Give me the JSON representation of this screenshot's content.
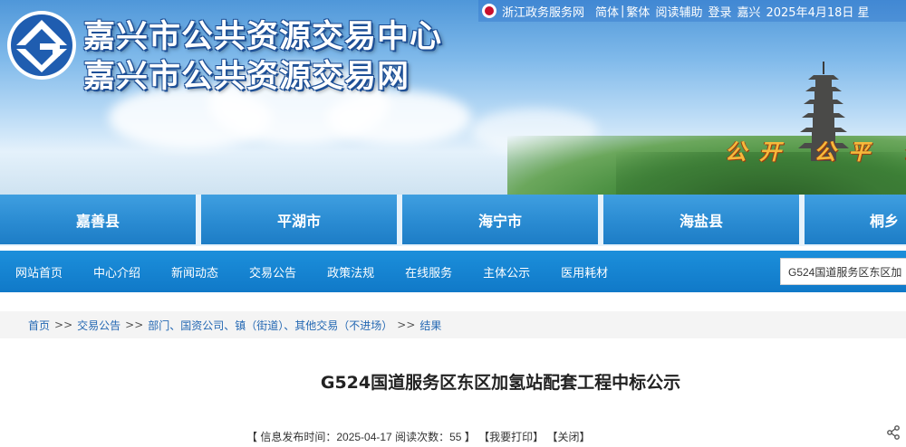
{
  "header": {
    "title_line1": "嘉兴市公共资源交易中心",
    "title_line2": "嘉兴市公共资源交易网",
    "slogan": "公开 公平 公",
    "topbar": {
      "gov_link": "浙江政务服务网",
      "simplified": "简体",
      "separator": "|",
      "traditional": "繁体",
      "reading_aid": "阅读辅助",
      "login": "登录",
      "city": "嘉兴",
      "date": "2025年4月18日 星"
    }
  },
  "city_tabs": [
    "嘉善县",
    "平湖市",
    "海宁市",
    "海盐县",
    "桐乡"
  ],
  "nav": {
    "items": [
      "网站首页",
      "中心介绍",
      "新闻动态",
      "交易公告",
      "政策法规",
      "在线服务",
      "主体公示",
      "医用耗材"
    ],
    "search_value": "G524国道服务区东区加"
  },
  "breadcrumb": [
    "首页",
    "交易公告",
    "部门、国资公司、镇（街道）、其他交易（不进场）",
    "结果"
  ],
  "breadcrumb_sep": ">>",
  "article": {
    "title": "G524国道服务区东区加氢站配套工程中标公示",
    "meta_prefix": "【 信息发布时间：",
    "publish_time": "2025-04-17",
    "views_label": "阅读次数：",
    "views": "55",
    "meta_suffix": " 】",
    "print_label": "【我要打印】",
    "close_label": "【关闭】"
  },
  "colors": {
    "nav_blue": "#1079c8",
    "tab_blue": "#2a8bd2",
    "link_blue": "#2468b3",
    "slogan_gold": "#f6b93b"
  },
  "icons": [
    "site-logo-icon",
    "gov-service-icon",
    "share-icon"
  ]
}
